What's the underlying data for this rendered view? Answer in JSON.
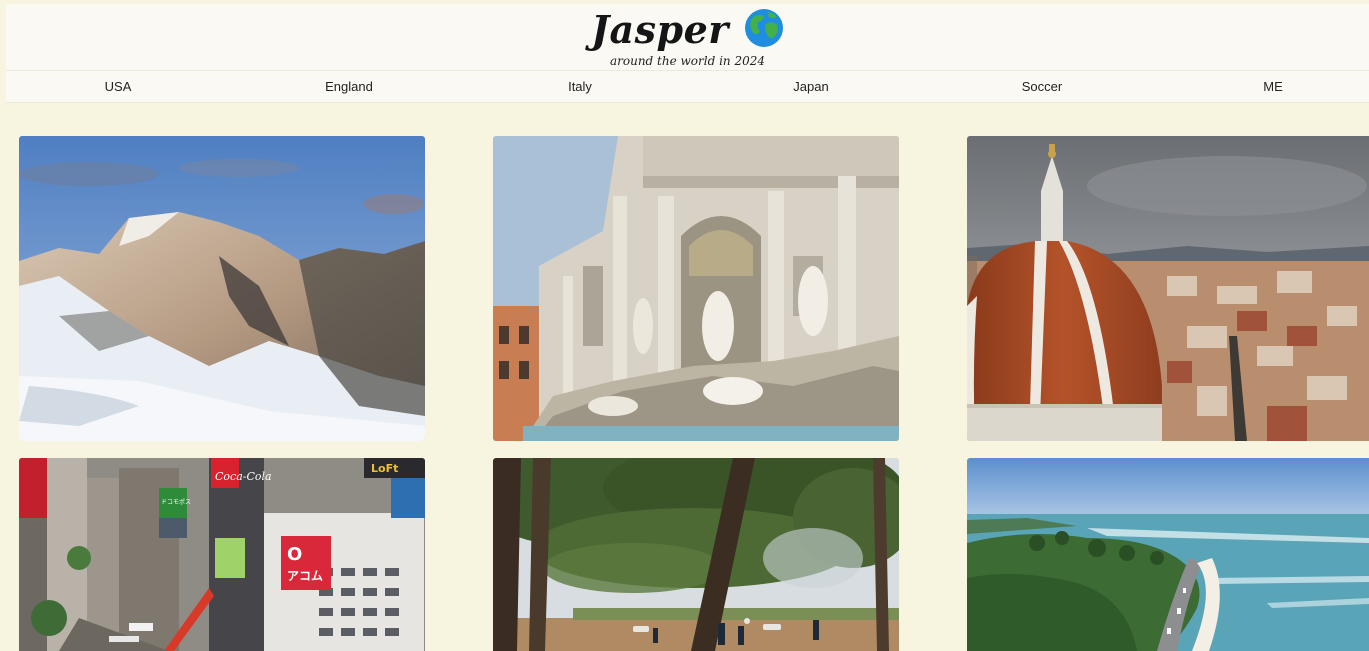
{
  "site": {
    "title": "Jasper",
    "subtitle": "around the world in 2024",
    "logo_icon": "globe-icon"
  },
  "nav": {
    "items": [
      {
        "label": "USA"
      },
      {
        "label": "England"
      },
      {
        "label": "Italy"
      },
      {
        "label": "Japan"
      },
      {
        "label": "Soccer"
      },
      {
        "label": "ME"
      }
    ]
  },
  "gallery": {
    "photos": [
      {
        "subject": "snowy-mountain"
      },
      {
        "subject": "trevi-fountain"
      },
      {
        "subject": "florence-duomo"
      },
      {
        "subject": "tokyo-shibuya"
      },
      {
        "subject": "pine-park"
      },
      {
        "subject": "coastal-highway"
      }
    ],
    "signs": {
      "cola": "Coca-Cola",
      "loft": "LoFt",
      "acom": "アコム",
      "acom_symbol": "O",
      "docomo": "ドコモポス"
    }
  },
  "colors": {
    "background": "#f7f5e0",
    "header": "#faf9f3"
  }
}
